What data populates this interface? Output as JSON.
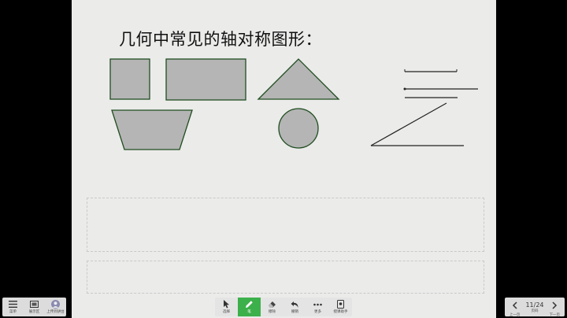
{
  "slide": {
    "title": "几何中常见的轴对称图形："
  },
  "left_toolbar": [
    {
      "label": "菜单",
      "icon": "menu-icon"
    },
    {
      "label": "展示区",
      "icon": "display-icon"
    },
    {
      "label": "上传到讲台",
      "icon": "avatar-icon"
    }
  ],
  "bottom_toolbar": [
    {
      "label": "选择",
      "icon": "cursor-icon",
      "active": false
    },
    {
      "label": "笔",
      "icon": "pen-icon",
      "active": true
    },
    {
      "label": "擦除",
      "icon": "eraser-icon",
      "active": false
    },
    {
      "label": "撤销",
      "icon": "undo-icon",
      "active": false
    },
    {
      "label": "更多",
      "icon": "more-icon",
      "active": false
    },
    {
      "label": "授课助手",
      "icon": "assistant-icon",
      "active": false
    }
  ],
  "pager": {
    "prev_label": "上一页",
    "page_text": "11/24",
    "page_label": "页码",
    "next_label": "下一页"
  },
  "colors": {
    "shape_fill": "#b5b5b5",
    "shape_stroke": "#1f4d1f",
    "active_tool": "#3cb04a"
  }
}
